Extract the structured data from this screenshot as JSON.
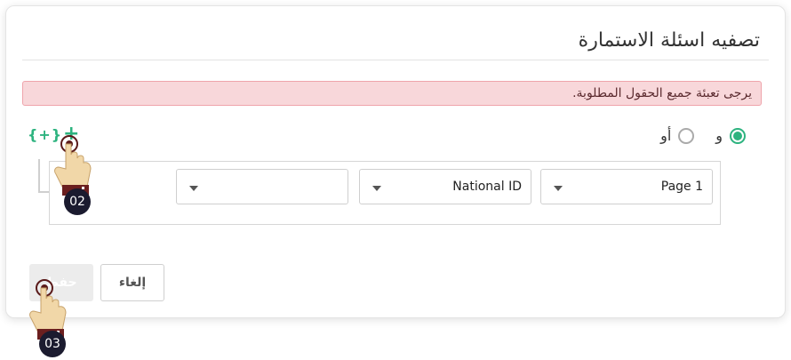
{
  "card": {
    "title": "تصفيه اسئلة الاستمارة",
    "alert": "يرجى تعبئة جميع الحقول المطلوبة."
  },
  "logic": {
    "and_label": "و",
    "or_label": "أو",
    "selected": "and",
    "add_group_label": "{+}",
    "add_condition_label": "+"
  },
  "condition": {
    "page_value": "Page 1",
    "field_value": "National ID",
    "operator_value": ""
  },
  "buttons": {
    "cancel_label": "إلغاء",
    "save_label": "حفظ"
  },
  "annotations": {
    "step_02": "02",
    "step_03": "03"
  },
  "colors": {
    "accent": "#2db37f",
    "alert_bg": "#f8d7da",
    "alert_border": "#efa4ab"
  }
}
